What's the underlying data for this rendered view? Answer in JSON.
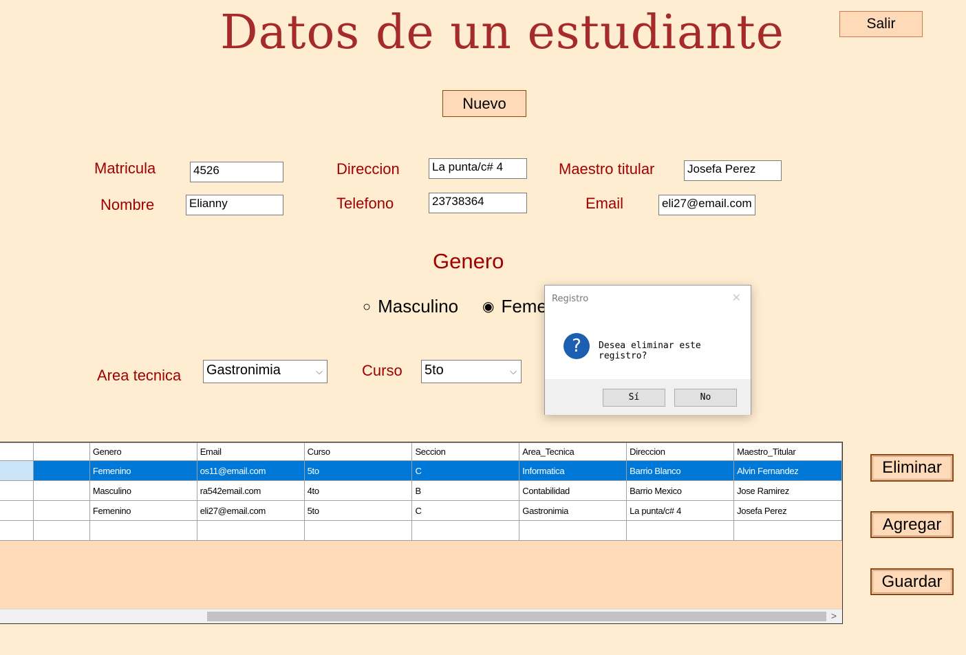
{
  "form": {
    "title": "Datos de un estudiante",
    "salir_label": "Salir",
    "nuevo_label": "Nuevo",
    "labels": {
      "matricula": "Matricula",
      "nombre": "Nombre",
      "direccion": "Direccion",
      "telefono": "Telefono",
      "maestro": "Maestro titular",
      "email": "Email",
      "genero": "Genero",
      "area": "Area tecnica",
      "curso": "Curso"
    },
    "values": {
      "matricula": "4526",
      "nombre": "Elianny",
      "direccion": "La punta/c# 4",
      "telefono": "23738364",
      "maestro": "Josefa Perez",
      "email": "eli27@email.com",
      "area": "Gastronimia",
      "curso": "5to"
    },
    "genero": {
      "masculino": "Masculino",
      "femenino": "Feme",
      "selected": "femenino"
    }
  },
  "side_buttons": {
    "eliminar": "Eliminar",
    "agregar": "Agregar",
    "guardar": "Guardar"
  },
  "grid": {
    "columns": [
      "",
      "",
      "Genero",
      "Email",
      "Curso",
      "Seccion",
      "Area_Tecnica",
      "Direccion",
      "Maestro_Titular"
    ],
    "rows": [
      {
        "selected": true,
        "cells": [
          "",
          "",
          "Femenino",
          "os11@email.com",
          "5to",
          "C",
          "Informatica",
          "Barrio Blanco",
          "Alvin Fernandez"
        ]
      },
      {
        "selected": false,
        "cells": [
          "",
          "",
          "Masculino",
          "ra542email.com",
          "4to",
          "B",
          "Contabilidad",
          "Barrio Mexico",
          "Jose Ramirez"
        ]
      },
      {
        "selected": false,
        "cells": [
          "",
          "",
          "Femenino",
          "eli27@email.com",
          "5to",
          "C",
          "Gastronimia",
          "La punta/c# 4",
          "Josefa Perez"
        ]
      },
      {
        "selected": false,
        "cells": [
          "",
          "",
          "",
          "",
          "",
          "",
          "",
          "",
          ""
        ]
      }
    ]
  },
  "dialog": {
    "title": "Registro",
    "message": "Desea eliminar este registro?",
    "icon": "question-icon",
    "yes_label": "Sí",
    "no_label": "No"
  },
  "colors": {
    "background": "#FFEDD2",
    "label": "#A00000",
    "title": "#A52A2A",
    "button": "#FFDAB9",
    "selection": "#0078D7"
  }
}
